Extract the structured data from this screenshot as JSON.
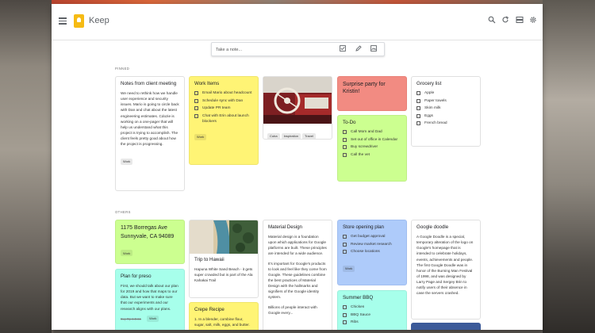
{
  "app": {
    "title": "Keep"
  },
  "toolbar": {
    "icons": [
      "menu-icon",
      "search-icon",
      "refresh-icon",
      "list-view-icon",
      "settings-icon"
    ]
  },
  "take_note": {
    "placeholder": "Take a note...",
    "icons": [
      "checkbox-icon",
      "pencil-icon",
      "image-icon"
    ]
  },
  "sections": {
    "pinned": "PINNED",
    "others": "OTHERS"
  },
  "pinned": {
    "client_meeting": {
      "title": "Notes from client meeting",
      "body": "We need to rethink how we handle user experience and security issues. Mario is going to circle back with Dan and chat about the latest engineering estimates. Cdozie is working on a one-pager that will help us understand what this project is trying to accomplish. The client feels pretty good about how the project is progressing.",
      "label": "Work"
    },
    "work_items": {
      "title": "Work Items",
      "items": [
        "Email Mario about headcount",
        "Schedule sync with Dan",
        "Update PR team",
        "Chat with Erin about launch blockers"
      ],
      "label": "Work"
    },
    "photo_note": {
      "labels": [
        "Cuba",
        "Inspiration",
        "Travel"
      ]
    },
    "surprise_party": {
      "title": "Surprise party for Kristin!"
    },
    "todo": {
      "title": "To-Do",
      "items": [
        "Call Mom and Dad",
        "Set out of office in Calendar",
        "Buy screwdriver",
        "Call the vet"
      ]
    },
    "grocery": {
      "title": "Grocery list",
      "items": [
        "Apple",
        "Paper towels",
        "Skim milk",
        "Eggs",
        "French bread"
      ]
    }
  },
  "others": {
    "address": {
      "line1": "1175 Borregas Ave",
      "line2": "Sunnyvale, CA 94089",
      "label": "Work"
    },
    "presentation": {
      "title": "Plan for preso",
      "body": "First, we should talk about our plan for 2019 and how that maps to our data. But we want to make sure that our experiments and our research aligns with our plans.",
      "done_item": "Buy flip 8.5x11",
      "label": "Work"
    },
    "hawaii": {
      "title": "Trip to Hawaii",
      "body": "Hapuna White Sand Beach - it gets super crowded but is part of the Ala Kahakai Trail"
    },
    "crepe": {
      "title": "Crepe Recipe",
      "body": "1. In a blender, combine flour, sugar, salt, milk, eggs, and butter."
    },
    "material_design": {
      "title": "Material Design",
      "body1": "Material design is a foundation upon which applications for Google platforms are built. These principles are intended for a wide audience.",
      "body2": "It's important for Google's products to look and feel like they come from Google. These guidelines combine the best practices of Material Design with the hallmarks and signifiers of the Google identity system.",
      "body3": "Billions of people interact with Google every..."
    },
    "store_opening": {
      "title": "Store opening plan",
      "items": [
        "Get budget approval",
        "Review market research",
        "Choose locations"
      ],
      "label": "Work"
    },
    "bbq": {
      "title": "Summer BBQ",
      "items": [
        "Chicken",
        "BBQ Sauce",
        "Ribs"
      ]
    },
    "doodle": {
      "title": "Google doodle",
      "body": "A Google Doodle is a special, temporary alteration of the logo on Google's homepage that is intended to celebrate holidays, events, achievements and people. The first Google Doodle was in honor of the Burning Man Festival of 1998, and was designed by Larry Page and Sergey Brin to notify users of their absence in case the servers crashed."
    }
  },
  "colors": {
    "yellow": "#fff475",
    "red": "#f28b82",
    "green": "#ccff90",
    "blue": "#aecbfa",
    "teal": "#a7ffeb",
    "logo": "#f6bb14"
  }
}
